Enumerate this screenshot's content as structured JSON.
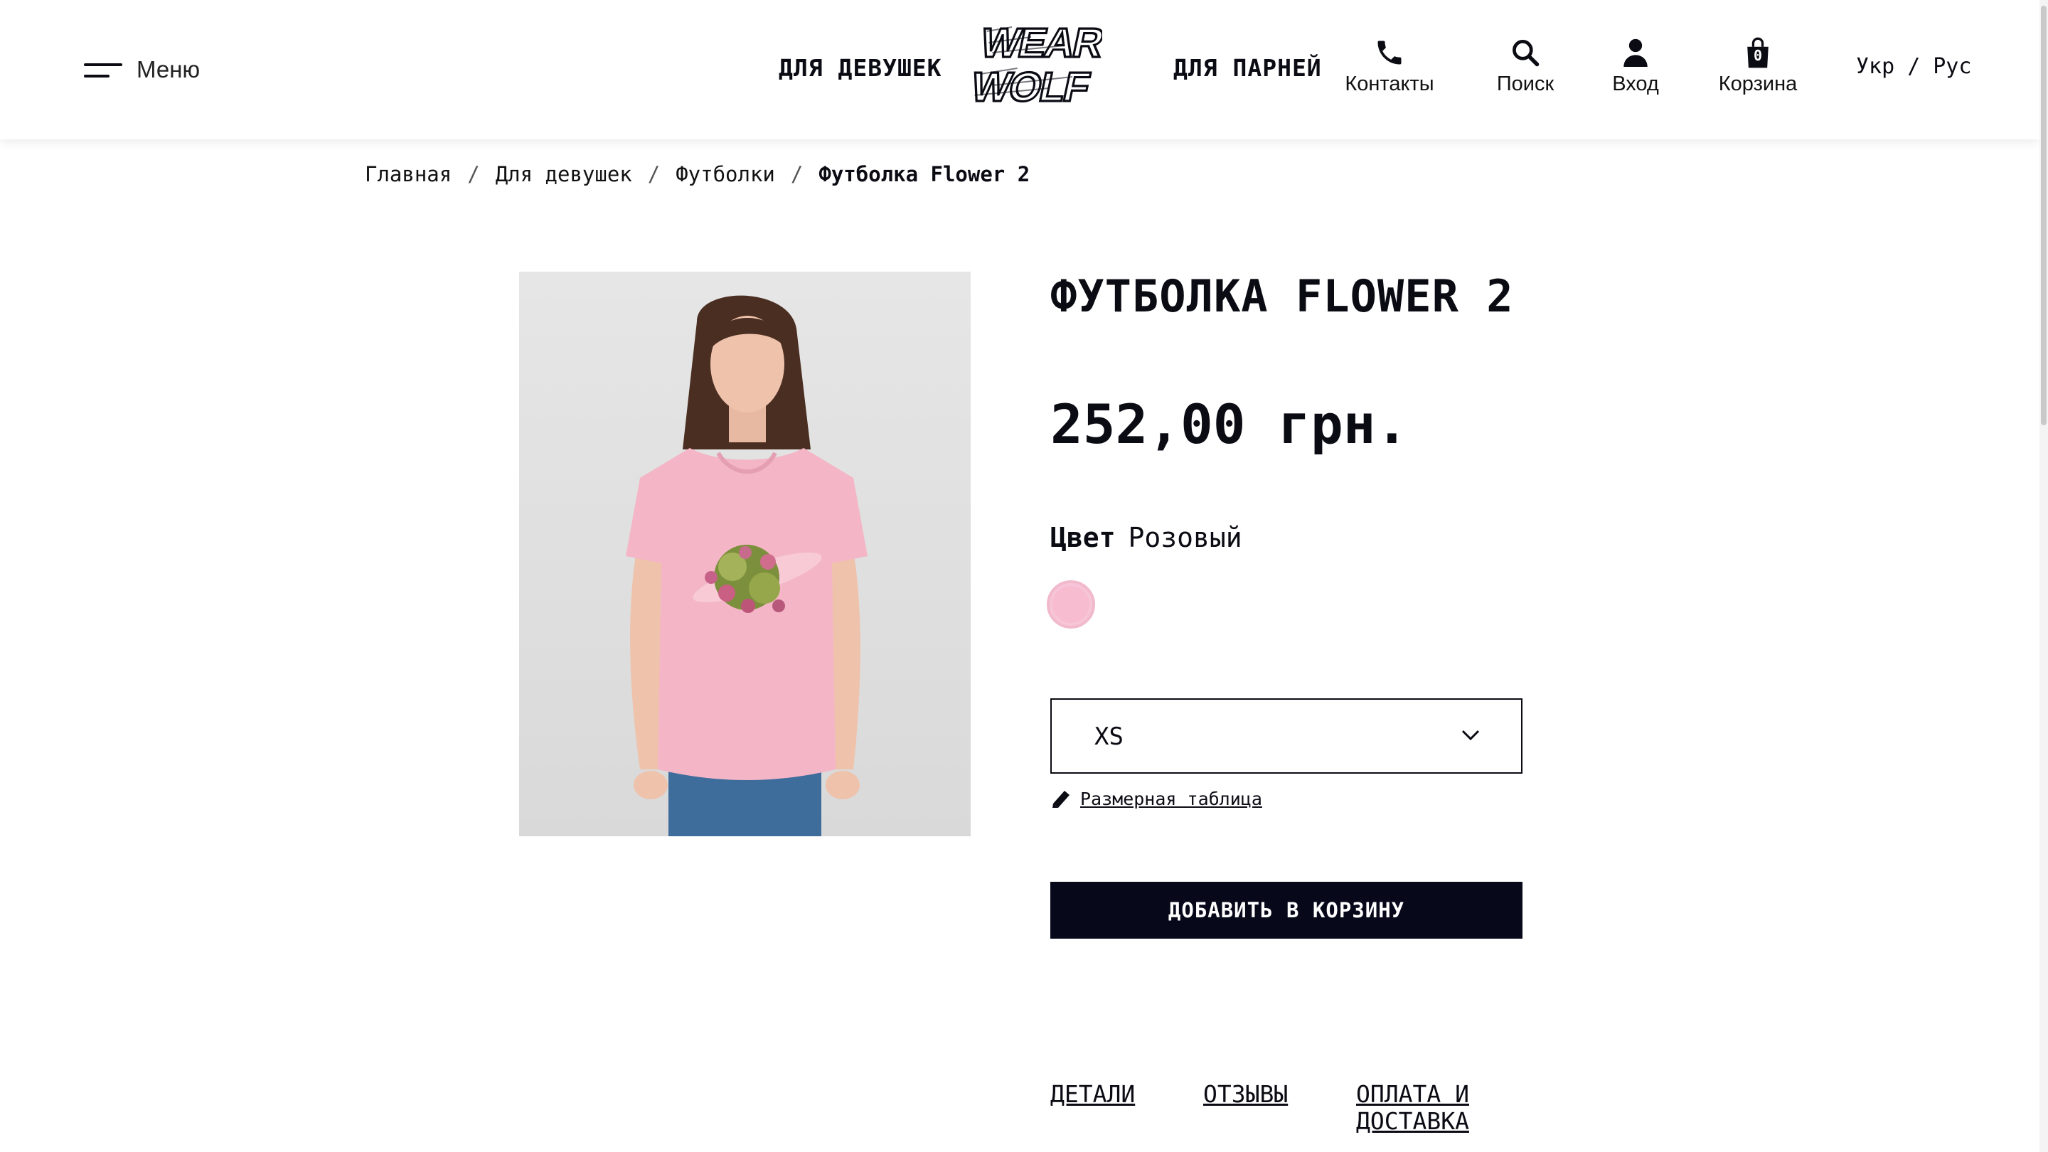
{
  "header": {
    "menu_label": "Меню",
    "nav_girls": "ДЛЯ ДЕВУШЕК",
    "nav_boys": "ДЛЯ ПАРНЕЙ",
    "logo_line1": "WEAR",
    "logo_line2": "WOLF",
    "contacts_label": "Контакты",
    "search_label": "Поиск",
    "login_label": "Вход",
    "cart_label": "Корзина",
    "cart_count": "0",
    "lang_ukr": "Укр",
    "lang_sep": "/",
    "lang_rus": "Рус"
  },
  "breadcrumb": {
    "items": [
      "Главная",
      "Для девушек",
      "Футболки"
    ],
    "separator": "/",
    "current": "Футболка Flower 2"
  },
  "product": {
    "title": "ФУТБОЛКА FLOWER 2",
    "price": "252,00 грн.",
    "color_label": "Цвет",
    "color_value": "Розовый",
    "swatch_color": "#f8bcd1",
    "size_selected": "XS",
    "size_table_label": "Размерная таблица",
    "add_to_cart": "ДОБАВИТЬ В КОРЗИНУ"
  },
  "tabs": {
    "details": "ДЕТАЛИ",
    "reviews": "ОТЗЫВЫ",
    "payment_line1": "ОПЛАТА И",
    "payment_line2": "ДОСТАВКА"
  },
  "icons": {
    "menu": "hamburger-icon",
    "contacts": "phone-icon",
    "search": "search-icon",
    "login": "user-icon",
    "cart": "bag-icon",
    "size_select": "chevron-down-icon",
    "size_table": "ruler-icon"
  },
  "colors": {
    "text": "#0b0b14",
    "button_bg": "#07081a",
    "tshirt_pink": "#f4b6c6",
    "image_bg": "#e2e2e2"
  }
}
